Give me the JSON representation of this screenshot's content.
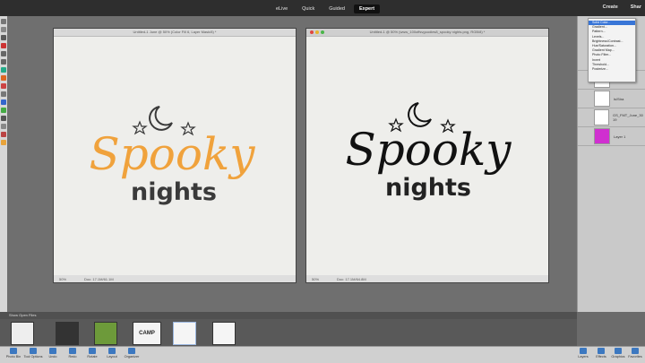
{
  "mode_tabs": [
    "eLive",
    "Quick",
    "Guided",
    "Expert"
  ],
  "top_right": {
    "create": "Create",
    "share": "Shar"
  },
  "left_doc": {
    "title": "Untitled-1 June @ 50% (Color Fill 6, Layer Mask/8) *",
    "zoom": "50%",
    "doc_size": "Doc: 17.1M/61.1M",
    "art_accent": "#f0a23c",
    "art_dark": "#3a3a3a"
  },
  "right_doc": {
    "title": "Untitled-1 @ 50% (www_100offsvgoodies8_spooky nights.png, RGB/8) *",
    "zoom": "50%",
    "doc_size": "Doc: 17.1M/64.8M",
    "art_color": "#111111"
  },
  "art_text": {
    "line1": "Spooky",
    "line2": "nights"
  },
  "context_menu": [
    "Solid Color...",
    "Gradient...",
    "Pattern...",
    "Levels...",
    "Brightness/Contrast...",
    "Hue/Saturation...",
    "Gradient Map...",
    "Photo Filter...",
    "Invert",
    "Threshold...",
    "Posterize..."
  ],
  "layers": [
    {
      "name": "Co"
    },
    {
      "name": ""
    },
    {
      "name": "ls/Stra"
    },
    {
      "name": "GS_FMT_June_30 19"
    },
    {
      "name": "Layer 1",
      "color": "#d02fd0"
    }
  ],
  "bin_label": "Show Open Files",
  "bottom_left": [
    "Photo Bin",
    "Tool Options",
    "Undo",
    "Redo",
    "Rotate",
    "Layout",
    "Organizer"
  ],
  "bottom_right": [
    "Layers",
    "Effects",
    "Graphics",
    "Favorites"
  ],
  "thumb_camp_text": "CAMP"
}
